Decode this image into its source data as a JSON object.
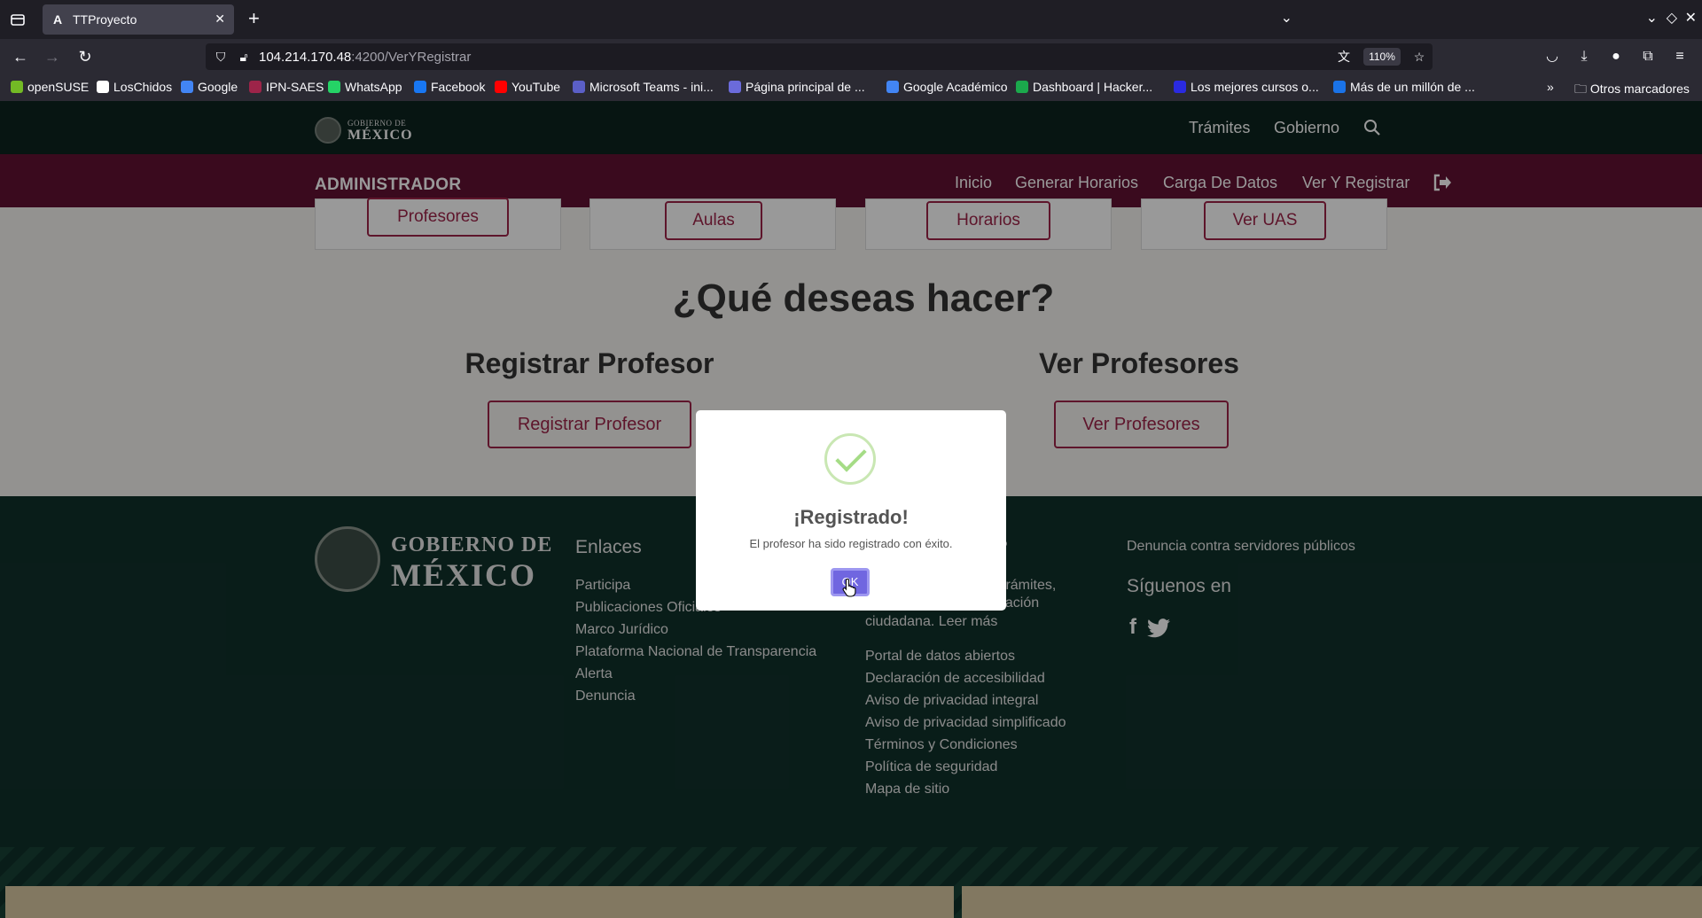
{
  "browser": {
    "tab_title": "TTProyecto",
    "tab_icon_letter": "A",
    "url_host": "104.214.170.48",
    "url_path": ":4200/VerYRegistrar",
    "zoom": "110%",
    "bookmarks": [
      {
        "label": "openSUSE",
        "color": "#73ba25"
      },
      {
        "label": "LosChidos",
        "color": "#ffffff"
      },
      {
        "label": "Google",
        "color": "#4285f4"
      },
      {
        "label": "IPN-SAES",
        "color": "#9d2449"
      },
      {
        "label": "WhatsApp",
        "color": "#25d366"
      },
      {
        "label": "Facebook",
        "color": "#1877f2"
      },
      {
        "label": "YouTube",
        "color": "#ff0000"
      },
      {
        "label": "Microsoft Teams - ini...",
        "color": "#5b5fc7"
      },
      {
        "label": "Página principal de ...",
        "color": "#6b6bdb"
      },
      {
        "label": "Google Académico",
        "color": "#4285f4"
      },
      {
        "label": "Dashboard | Hacker...",
        "color": "#1ba94c"
      },
      {
        "label": "Los mejores cursos o...",
        "color": "#2a2ae0"
      },
      {
        "label": "Más de un millón de ...",
        "color": "#1a73e8"
      }
    ],
    "other_bookmarks": "Otros marcadores"
  },
  "gov_header": {
    "logo_small": "GOBIERNO DE",
    "logo_big": "MÉXICO",
    "nav": [
      "Trámites",
      "Gobierno"
    ]
  },
  "admin_bar": {
    "title": "ADMINISTRADOR",
    "links": [
      "Inicio",
      "Generar Horarios",
      "Carga De Datos",
      "Ver Y Registrar"
    ]
  },
  "main": {
    "cards": [
      "Profesores",
      "Aulas",
      "Horarios",
      "Ver UAS"
    ],
    "question": "¿Qué deseas hacer?",
    "sections": [
      {
        "title": "Registrar Profesor",
        "button": "Registrar Profesor"
      },
      {
        "title": "Ver Profesores",
        "button": "Ver Profesores"
      }
    ]
  },
  "footer": {
    "logo_line1": "GOBIERNO DE",
    "logo_line2": "MÉXICO",
    "enlaces_title": "Enlaces",
    "enlaces": [
      "Participa",
      "Publicaciones Oficiales",
      "Marco Jurídico",
      "Plataforma Nacional de Transparencia",
      "Alerta",
      "Denuncia"
    ],
    "middle_partial_title": "?",
    "middle_partial_lines": [
      "trámites,",
      "pación",
      "ciudadana. Leer más"
    ],
    "middle_links": [
      "Portal de datos abiertos",
      "Declaración de accesibilidad",
      "Aviso de privacidad integral",
      "Aviso de privacidad simplificado",
      "Términos y Condiciones",
      "Política de seguridad",
      "Mapa de sitio"
    ],
    "denuncia": "Denuncia contra servidores públicos",
    "siguenos": "Síguenos en"
  },
  "modal": {
    "title": "¡Registrado!",
    "text": "El profesor ha sido registrado con éxito.",
    "ok": "OK"
  }
}
